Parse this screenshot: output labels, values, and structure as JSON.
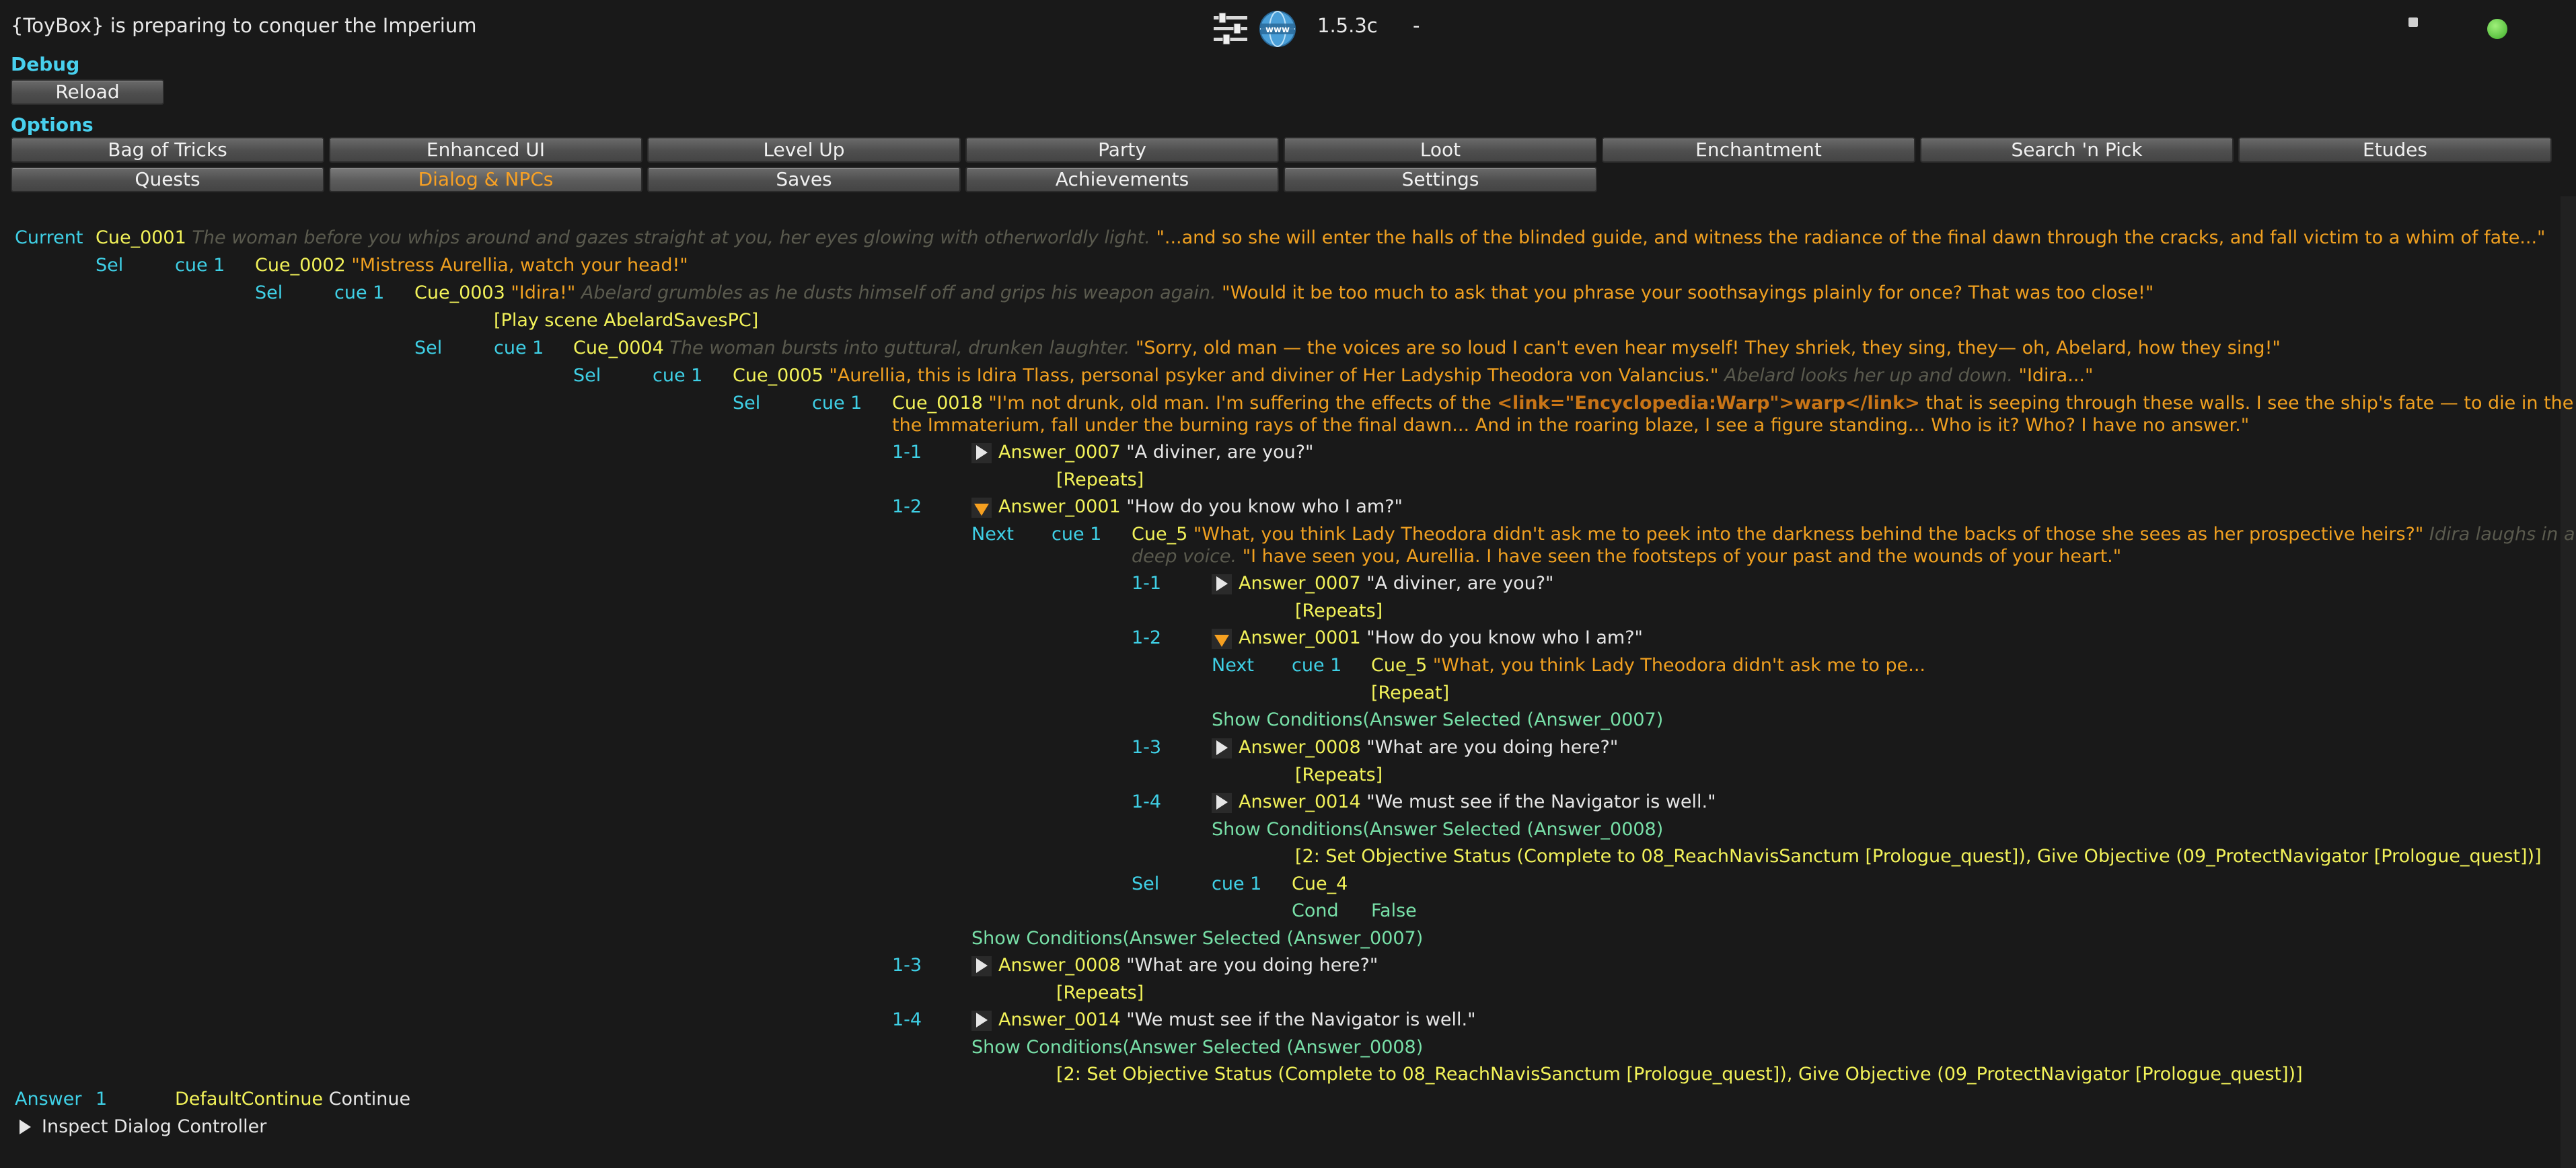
{
  "header": {
    "title": "{ToyBox} is preparing to conquer the Imperium",
    "version": "1.5.3c",
    "dash": "-"
  },
  "debug": {
    "heading": "Debug",
    "reload": "Reload"
  },
  "options": {
    "heading": "Options"
  },
  "tabs_row1": [
    "Bag of Tricks",
    "Enhanced UI",
    "Level Up",
    "Party",
    "Loot",
    "Enchantment",
    "Search 'n Pick",
    "Etudes"
  ],
  "tabs_row2": [
    "Quests",
    "Dialog & NPCs",
    "Saves",
    "Achievements",
    "Settings"
  ],
  "active_tab": "Dialog & NPCs",
  "colors": {
    "accent_orange": "#f0a020",
    "cue_yellow": "#f2f259",
    "label_cyan": "#3fd0e6",
    "cond_green": "#78e0a8"
  },
  "dialog": {
    "current": {
      "label": "Current",
      "cue": "Cue_0001",
      "desc": "The woman before you whips around and gazes straight at you, her eyes glowing with otherworldly light.",
      "text": "\"...and so she will enter the halls of the blinded guide, and witness the radiance of the final dawn through the cracks, and fall victim to a whim of fate...\""
    },
    "l1": {
      "sel": "Sel",
      "cue_n": "cue 1",
      "cue": "Cue_0002",
      "text": "\"Mistress Aurellia, watch your head!\""
    },
    "l2": {
      "sel": "Sel",
      "cue_n": "cue 1",
      "cue": "Cue_0003",
      "text": "\"Idira!\"",
      "desc": "Abelard grumbles as he dusts himself off and grips his weapon again.",
      "text2": "\"Would it be too much to ask that you phrase your soothsayings plainly for once? That was too close!\""
    },
    "l2_action": "[Play scene AbelardSavesPC]",
    "l3": {
      "sel": "Sel",
      "cue_n": "cue 1",
      "cue": "Cue_0004",
      "desc": "The woman bursts into guttural, drunken laughter.",
      "text": "\"Sorry, old man — the voices are so loud I can't even hear myself! They shriek, they sing, they— oh, Abelard, how they sing!\""
    },
    "l4": {
      "sel": "Sel",
      "cue_n": "cue 1",
      "cue": "Cue_0005",
      "text": "\"Aurellia, this is Idira Tlass, personal psyker and diviner of Her Ladyship Theodora von Valancius.\"",
      "desc": "Abelard looks her up and down.",
      "text2": "\"Idira...\""
    },
    "l5": {
      "sel": "Sel",
      "cue_n": "cue 1",
      "cue": "Cue_0018",
      "text_a": "\"I'm not drunk, old man. I'm suffering the effects of the",
      "link": "<link=\"Encyclopedia:Warp\">warp</link>",
      "text_b": "that is seeping through these walls. I see the ship's fate — to die in the waves of",
      "text_c": "the Immaterium, fall under the burning rays of the final dawn... And in the roaring blaze, I see a figure standing... Who is it? Who? I have no answer.\""
    },
    "a1": {
      "num": "1-1",
      "answer": "Answer_0007",
      "text": "\"A diviner, are you?\"",
      "repeats": "[Repeats]"
    },
    "a2": {
      "num": "1-2",
      "answer": "Answer_0001",
      "text": "\"How do you know who I am?\""
    },
    "next": {
      "label": "Next",
      "cue_n": "cue 1",
      "cue": "Cue_5",
      "text": "\"What, you think Lady Theodora didn't ask me to peek into the darkness behind the backs of those she sees as her prospective heirs?\"",
      "desc_a": "Idira laughs in a",
      "desc_b": "deep voice.",
      "text2": "\"I have seen you, Aurellia. I have seen the footsteps of your past and the wounds of your heart.\""
    },
    "na1": {
      "num": "1-1",
      "answer": "Answer_0007",
      "text": "\"A diviner, are you?\"",
      "repeats": "[Repeats]"
    },
    "na2": {
      "num": "1-2",
      "answer": "Answer_0001",
      "text": "\"How do you know who I am?\""
    },
    "nn": {
      "label": "Next",
      "cue_n": "cue 1",
      "cue": "Cue_5",
      "text": "\"What, you think Lady Theodora didn't ask me to pe...",
      "repeat": "[Repeat]"
    },
    "nn_cond": "Show Conditions(Answer Selected (Answer_0007)",
    "na3": {
      "num": "1-3",
      "answer": "Answer_0008",
      "text": "\"What are you doing here?\"",
      "repeats": "[Repeats]"
    },
    "na4": {
      "num": "1-4",
      "answer": "Answer_0014",
      "text": "\"We must see if the Navigator is well.\""
    },
    "na4_cond": "Show Conditions(Answer Selected (Answer_0008)",
    "na4_action": "[2: Set Objective Status (Complete to 08_ReachNavisSanctum [Prologue_quest]), Give Objective (09_ProtectNavigator [Prologue_quest])]",
    "nsel": {
      "sel": "Sel",
      "cue_n": "cue 1",
      "cue": "Cue_4",
      "cond": "Cond",
      "cond_val": "False"
    },
    "a2_cond": "Show Conditions(Answer Selected (Answer_0007)",
    "a3": {
      "num": "1-3",
      "answer": "Answer_0008",
      "text": "\"What are you doing here?\"",
      "repeats": "[Repeats]"
    },
    "a4": {
      "num": "1-4",
      "answer": "Answer_0014",
      "text": "\"We must see if the Navigator is well.\""
    },
    "a4_cond": "Show Conditions(Answer Selected (Answer_0008)",
    "a4_action": "[2: Set Objective Status (Complete to 08_ReachNavisSanctum [Prologue_quest]), Give Objective (09_ProtectNavigator [Prologue_quest])]"
  },
  "footer": {
    "answer_label": "Answer",
    "answer_n": "1",
    "default": "DefaultContinue",
    "continue": "Continue",
    "inspect": "Inspect Dialog Controller"
  },
  "icons": [
    "sliders-icon",
    "www-globe-icon",
    "status-green-icon"
  ]
}
